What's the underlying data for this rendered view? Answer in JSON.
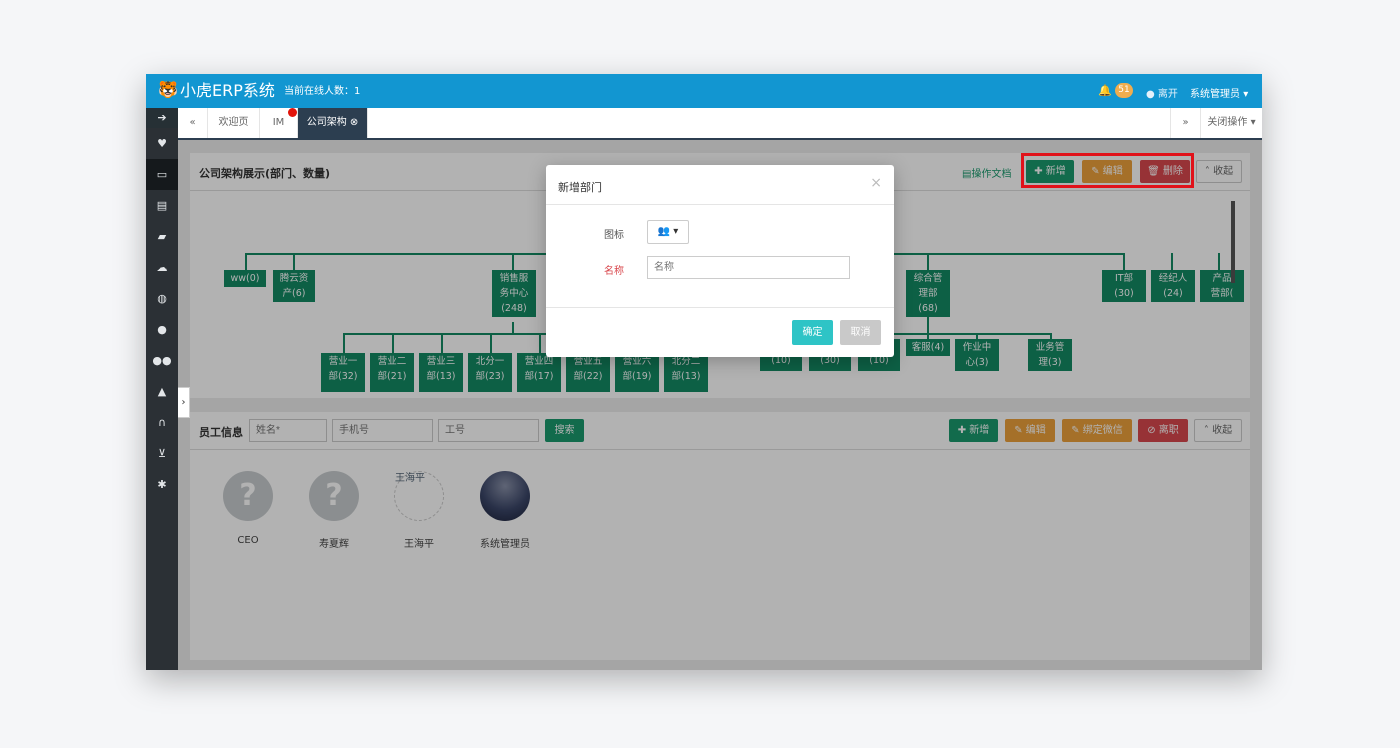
{
  "header": {
    "app_title": "小虎ERP系统",
    "online_count": "当前在线人数：1",
    "notif_count": "51",
    "leave_label": "离开",
    "user_label": "系统管理员"
  },
  "sidebar": {
    "items": [
      {
        "icon": "arrow-right-icon",
        "glyph": "➔"
      },
      {
        "icon": "heart-icon",
        "glyph": "♥"
      },
      {
        "icon": "monitor-icon",
        "glyph": "▭"
      },
      {
        "icon": "card-icon",
        "glyph": "▤"
      },
      {
        "icon": "book-icon",
        "glyph": "▰"
      },
      {
        "icon": "cloud-upload-icon",
        "glyph": "☁"
      },
      {
        "icon": "globe-icon",
        "glyph": "◍"
      },
      {
        "icon": "user-icon",
        "glyph": "●"
      },
      {
        "icon": "users-icon",
        "glyph": "●●"
      },
      {
        "icon": "road-icon",
        "glyph": "▲"
      },
      {
        "icon": "headphones-icon",
        "glyph": "∩"
      },
      {
        "icon": "cart-icon",
        "glyph": "⊻"
      },
      {
        "icon": "gear-icon",
        "glyph": "✱"
      }
    ]
  },
  "tabs": {
    "prev": "«",
    "next": "»",
    "items": [
      "欢迎页",
      "IM",
      "公司架构 ⊗"
    ],
    "close_ops": "关闭操作 ▾"
  },
  "org_panel": {
    "title": "公司架构展示(部门、数量)",
    "doc_link": "操作文档",
    "add": "✚ 新增",
    "edit": "✎ 编辑",
    "delete": "🗑 删除",
    "collapse": "˄ 收起",
    "nodes": [
      {
        "line1": "ww(0)",
        "line2": "",
        "line3": ""
      },
      {
        "line1": "腾云资",
        "line2": "产(6)",
        "line3": ""
      },
      {
        "line1": "销售服",
        "line2": "务中心",
        "line3": "(248)"
      },
      {
        "line1": "综合管",
        "line2": "理部(68)",
        "line3": ""
      },
      {
        "line1": "IT部",
        "line2": "(30)",
        "line3": ""
      },
      {
        "line1": "经纪人",
        "line2": "(24)",
        "line3": ""
      },
      {
        "line1": "产品",
        "line2": "营部(",
        "line3": ""
      },
      {
        "line1": "营业一",
        "line2": "部(32)",
        "line3": ""
      },
      {
        "line1": "营业二",
        "line2": "部(21)",
        "line3": ""
      },
      {
        "line1": "营业三",
        "line2": "部(13)",
        "line3": ""
      },
      {
        "line1": "北分一",
        "line2": "部(23)",
        "line3": ""
      },
      {
        "line1": "营业四",
        "line2": "部(17)",
        "line3": ""
      },
      {
        "line1": "营业五",
        "line2": "部(22)",
        "line3": ""
      },
      {
        "line1": "营业六",
        "line2": "部(19)",
        "line3": ""
      },
      {
        "line1": "北分二",
        "line2": "部(13)",
        "line3": ""
      },
      {
        "line1": "(10)",
        "line2": "",
        "line3": ""
      },
      {
        "line1": "(30)",
        "line2": "",
        "line3": ""
      },
      {
        "line1": "(10)",
        "line2": "",
        "line3": ""
      },
      {
        "line1": "客服(4)",
        "line2": "",
        "line3": ""
      },
      {
        "line1": "作业中",
        "line2": "心(3)",
        "line3": ""
      },
      {
        "line1": "业务管",
        "line2": "理(3)",
        "line3": ""
      }
    ]
  },
  "staff_panel": {
    "title": "员工信息",
    "name_placeholder": "姓名*",
    "phone_placeholder": "手机号",
    "id_placeholder": "工号",
    "search": "搜索",
    "add": "✚ 新增",
    "edit": "✎ 编辑",
    "bind_wechat": "✎ 绑定微信",
    "resign": "⊘ 离职",
    "collapse": "˄ 收起",
    "employees": [
      {
        "name": "CEO",
        "avatar": "?"
      },
      {
        "name": "寿夏辉",
        "avatar": "?"
      },
      {
        "name": "王海平",
        "avatar": "王海平"
      },
      {
        "name": "系统管理员",
        "avatar": ""
      }
    ]
  },
  "modal": {
    "title": "新增部门",
    "close": "×",
    "icon_label": "图标",
    "icon_value": "👥 ▾",
    "name_label": "名称",
    "name_placeholder": "名称",
    "ok": "确定",
    "cancel": "取消"
  },
  "colors": {
    "header_bg": "#1296d1",
    "node_green": "#138a64",
    "add_green": "#1a9a6e",
    "edit_orange": "#eca13c",
    "delete_red": "#d9484e",
    "ok_teal": "#2ec4c6",
    "highlight_red": "#e1121a"
  }
}
